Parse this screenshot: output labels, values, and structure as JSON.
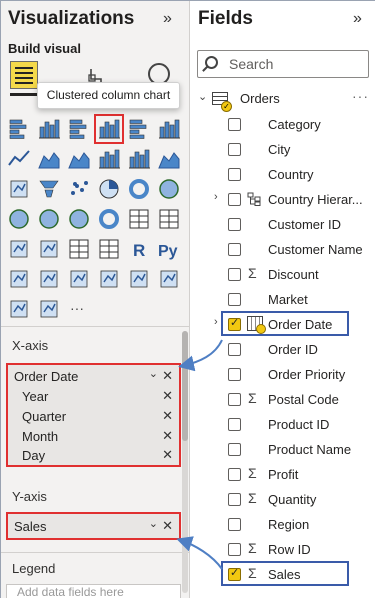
{
  "visualizations": {
    "title": "Visualizations",
    "collapse_glyph": "»",
    "build_label": "Build visual",
    "tooltip": "Clustered column chart",
    "selected_icon": "clustered-column-chart-icon"
  },
  "x_axis": {
    "label": "X-axis",
    "field": "Order Date",
    "items": [
      "Year",
      "Quarter",
      "Month",
      "Day"
    ]
  },
  "y_axis": {
    "label": "Y-axis",
    "field": "Sales"
  },
  "legend": {
    "label": "Legend",
    "placeholder": "Add data fields here"
  },
  "fields": {
    "title": "Fields",
    "collapse_glyph": "»",
    "search_placeholder": "Search",
    "table_name": "Orders",
    "more_glyph": "···",
    "items": [
      {
        "label": "Category",
        "checked": false,
        "type": "text"
      },
      {
        "label": "City",
        "checked": false,
        "type": "text"
      },
      {
        "label": "Country",
        "checked": false,
        "type": "text"
      },
      {
        "label": "Country Hierar...",
        "checked": false,
        "type": "hierarchy"
      },
      {
        "label": "Customer ID",
        "checked": false,
        "type": "text"
      },
      {
        "label": "Customer Name",
        "checked": false,
        "type": "text"
      },
      {
        "label": "Discount",
        "checked": false,
        "type": "sum"
      },
      {
        "label": "Market",
        "checked": false,
        "type": "text"
      },
      {
        "label": "Order Date",
        "checked": true,
        "type": "date"
      },
      {
        "label": "Order ID",
        "checked": false,
        "type": "text"
      },
      {
        "label": "Order Priority",
        "checked": false,
        "type": "text"
      },
      {
        "label": "Postal Code",
        "checked": false,
        "type": "sum"
      },
      {
        "label": "Product ID",
        "checked": false,
        "type": "text"
      },
      {
        "label": "Product Name",
        "checked": false,
        "type": "text"
      },
      {
        "label": "Profit",
        "checked": false,
        "type": "sum"
      },
      {
        "label": "Quantity",
        "checked": false,
        "type": "sum"
      },
      {
        "label": "Region",
        "checked": false,
        "type": "text"
      },
      {
        "label": "Row ID",
        "checked": false,
        "type": "sum"
      },
      {
        "label": "Sales",
        "checked": true,
        "type": "sum"
      }
    ]
  },
  "colors": {
    "accent_yellow": "#f2c811",
    "highlight_red": "#e03030",
    "highlight_blue": "#3a5ba9",
    "arrow_blue": "#4f7fc4"
  }
}
